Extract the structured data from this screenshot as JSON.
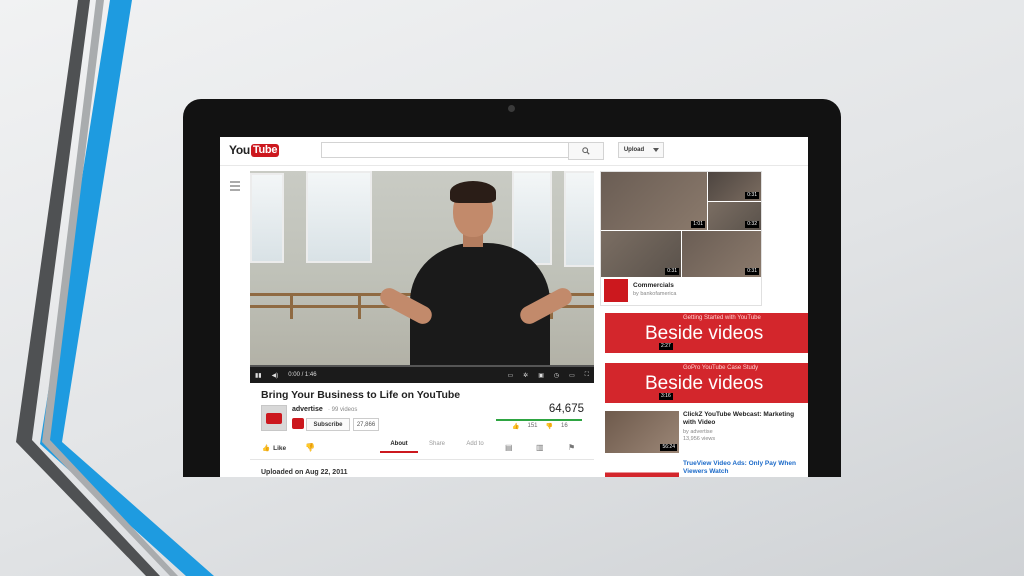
{
  "colors": {
    "accent": "#cc181e",
    "slide_blue": "#1e9be0",
    "slide_gray": "#5f6163",
    "ad_red": "#d3262c",
    "green": "#2ea542"
  },
  "header": {
    "logo_you": "You",
    "logo_tube": "Tube",
    "search_placeholder": "",
    "search_icon": "search-icon",
    "upload_label": "Upload",
    "upload_menu_icon": "chevron-down-icon"
  },
  "guide": {
    "icon": "hamburger-icon"
  },
  "player": {
    "time": "0:00 / 1:46",
    "progress_fraction": 0.0,
    "icons": [
      "pause-icon",
      "volume-icon",
      "captions-icon",
      "settings-icon",
      "annotations-icon",
      "watch-later-icon",
      "theater-icon",
      "fullscreen-icon"
    ]
  },
  "video": {
    "title": "Bring Your Business to Life on YouTube",
    "channel": "advertise",
    "channel_videos": "· 99 videos",
    "subscribe_label": "Subscribe",
    "subscriber_count": "27,866",
    "views": "64,675",
    "likes": "151",
    "dislikes": "16",
    "like_label": "Like",
    "uploaded": "Uploaded on Aug 22, 2011"
  },
  "tabs": [
    {
      "label": "About",
      "active": true
    },
    {
      "label": "Share",
      "active": false
    },
    {
      "label": "Add to",
      "active": false
    }
  ],
  "sidebar": {
    "playlist": {
      "title": "Commercials",
      "byline": "by bankofamerica",
      "durations": [
        "0:31",
        "0:32",
        "1:01",
        "0:31",
        "0:31"
      ]
    },
    "ads": [
      {
        "small": "Getting Started with YouTube",
        "big": "Beside videos",
        "duration": "2:27"
      },
      {
        "small": "GoPro YouTube Case Study",
        "big": "Beside videos",
        "duration": "3:16"
      }
    ],
    "related": [
      {
        "title": "ClickZ YouTube Webcast: Marketing with Video",
        "by": "by advertise",
        "views": "13,956 views",
        "duration": "56:24"
      },
      {
        "title": "TrueView Video Ads: Only Pay When Viewers Watch",
        "by": "",
        "views": "",
        "duration": ""
      }
    ]
  }
}
